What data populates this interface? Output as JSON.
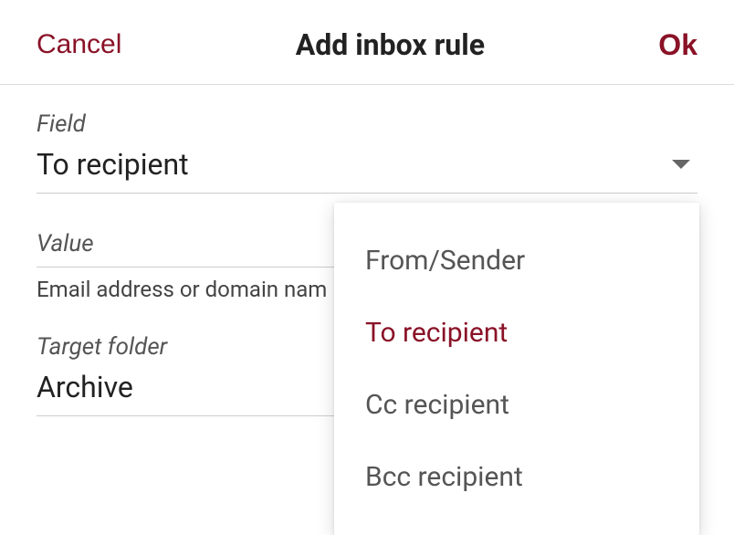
{
  "header": {
    "cancel_label": "Cancel",
    "title": "Add inbox rule",
    "ok_label": "Ok"
  },
  "form": {
    "field": {
      "label": "Field",
      "value": "To recipient",
      "options": [
        {
          "label": "From/Sender",
          "selected": false
        },
        {
          "label": "To recipient",
          "selected": true
        },
        {
          "label": "Cc recipient",
          "selected": false
        },
        {
          "label": "Bcc recipient",
          "selected": false
        }
      ]
    },
    "value": {
      "label": "Value",
      "hint": "Email address or domain nam"
    },
    "target_folder": {
      "label": "Target folder",
      "value": "Archive"
    }
  },
  "colors": {
    "accent": "#8a1227"
  }
}
